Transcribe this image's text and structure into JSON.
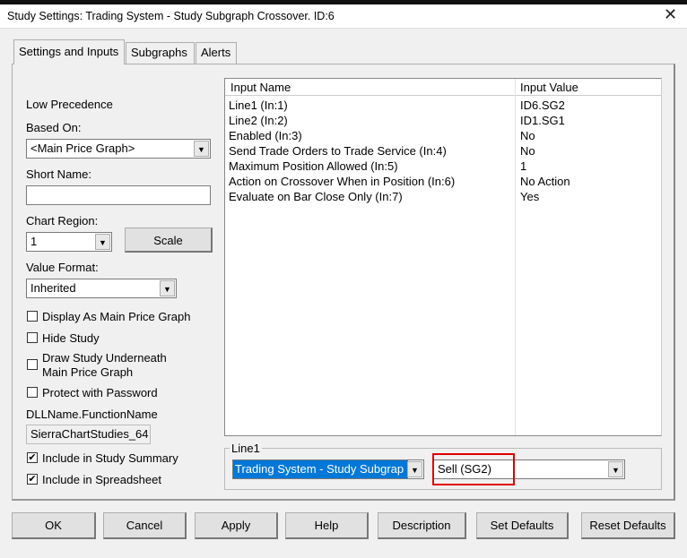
{
  "window": {
    "title": "Study Settings: Trading System - Study Subgraph Crossover. ID:6",
    "close": "✕"
  },
  "tabs": [
    "Settings and Inputs",
    "Subgraphs",
    "Alerts"
  ],
  "left": {
    "precedence": "Low Precedence",
    "based_on_label": "Based On:",
    "based_on_value": "<Main Price Graph>",
    "short_name_label": "Short Name:",
    "short_name_value": "",
    "chart_region_label": "Chart Region:",
    "chart_region_value": "1",
    "scale_label": "Scale",
    "value_format_label": "Value Format:",
    "value_format_value": "Inherited",
    "checkboxes": [
      {
        "label": "Display As Main Price Graph",
        "checked": false
      },
      {
        "label": "Hide Study",
        "checked": false
      },
      {
        "label": "Draw Study Underneath",
        "label2": "Main Price Graph",
        "checked": false
      },
      {
        "label": "Protect with Password",
        "checked": false
      }
    ],
    "dll_label": "DLLName.FunctionName",
    "dll_value": "SierraChartStudies_64",
    "checkboxes2": [
      {
        "label": "Include in Study Summary",
        "checked": true,
        "mark": "✔"
      },
      {
        "label": "Include in Spreadsheet",
        "checked": true,
        "mark": "✔"
      }
    ]
  },
  "table": {
    "headers": [
      "Input Name",
      "Input Value"
    ],
    "rows": [
      [
        "Line1  (In:1)",
        "ID6.SG2"
      ],
      [
        "Line2  (In:2)",
        "ID1.SG1"
      ],
      [
        "Enabled  (In:3)",
        "No"
      ],
      [
        "Send Trade Orders to Trade Service  (In:4)",
        "No"
      ],
      [
        "Maximum Position Allowed  (In:5)",
        "1"
      ],
      [
        "Action on Crossover When in Position  (In:6)",
        "No Action"
      ],
      [
        "Evaluate on Bar Close Only  (In:7)",
        "Yes"
      ]
    ]
  },
  "group": {
    "label": "Line1",
    "study_value": "Trading System - Study Subgrap",
    "subgraph_value": "Sell (SG2)",
    "highlight_color": "#e00000"
  },
  "buttons": {
    "ok": "OK",
    "cancel": "Cancel",
    "apply": "Apply",
    "help": "Help",
    "description": "Description",
    "set_defaults": "Set Defaults",
    "reset_defaults": "Reset Defaults"
  }
}
